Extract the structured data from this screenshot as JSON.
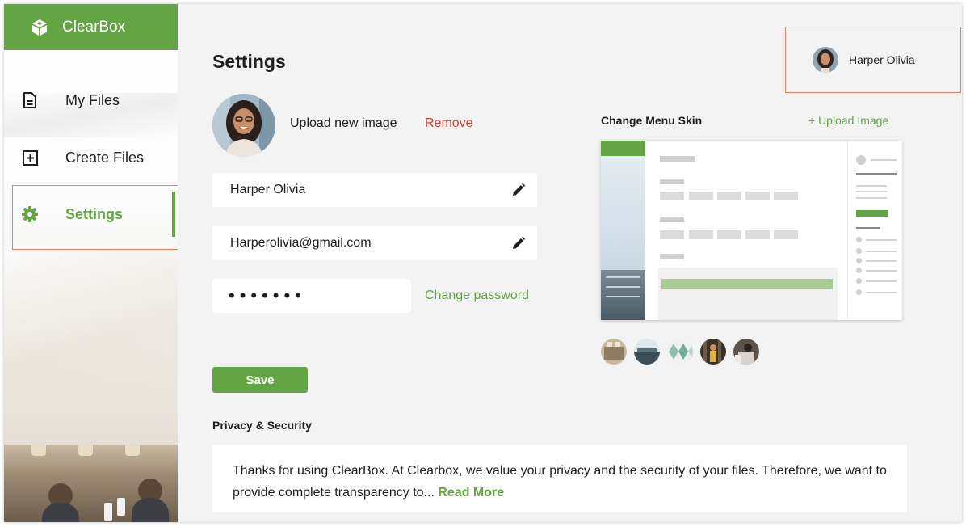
{
  "app": {
    "name": "ClearBox"
  },
  "sidebar": {
    "items": [
      {
        "label": "My Files",
        "icon": "document-icon"
      },
      {
        "label": "Create Files",
        "icon": "plus-square-icon"
      },
      {
        "label": "Settings",
        "icon": "gear-icon",
        "active": true
      }
    ]
  },
  "header": {
    "title": "Settings",
    "user_name": "Harper Olivia"
  },
  "profile": {
    "upload_label": "Upload new image",
    "remove_label": "Remove",
    "name_value": "Harper Olivia",
    "email_value": "Harperolivia@gmail.com",
    "password_mask": "•••••••",
    "change_password_label": "Change password",
    "save_label": "Save"
  },
  "skin": {
    "title": "Change Menu Skin",
    "upload_label": "+ Upload Image"
  },
  "privacy": {
    "title": "Privacy & Security",
    "text": "Thanks for using ClearBox. At Clearbox, we value your privacy and the security of your files. Therefore, we want to provide complete transparency to...",
    "read_more": "Read More"
  },
  "colors": {
    "accent": "#63a544",
    "danger": "#d93b2f",
    "highlight": "#ef7f5b",
    "background": "#f3f3f3"
  }
}
